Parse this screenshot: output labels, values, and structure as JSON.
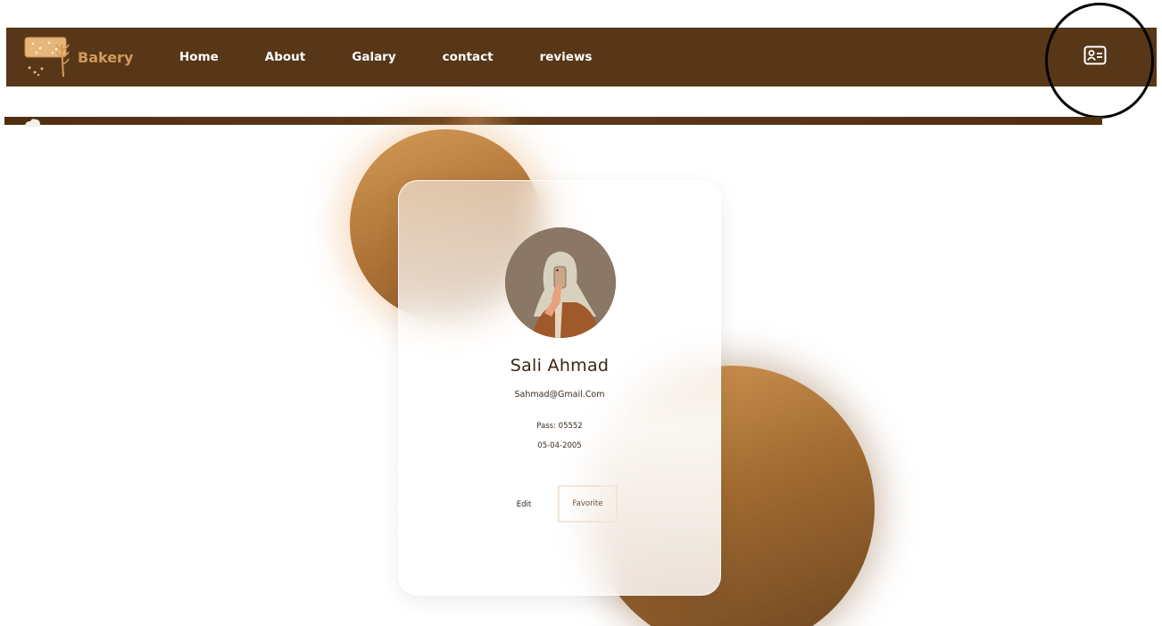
{
  "navbar": {
    "brand_name": "Bakery",
    "links": [
      "Home",
      "About",
      "Galary",
      "contact",
      "reviews"
    ],
    "profile_icon": "id-card-icon"
  },
  "profile": {
    "name": "Sali Ahmad",
    "email": "Sahmad@Gmail.Com",
    "pass": "Pass: 05552",
    "dob": "05-04-2005",
    "edit_label": "Edit",
    "favorite_label": "Favorite"
  },
  "colors": {
    "nav_bg": "#573718",
    "brand": "#d39959",
    "blob": "#c28646"
  }
}
